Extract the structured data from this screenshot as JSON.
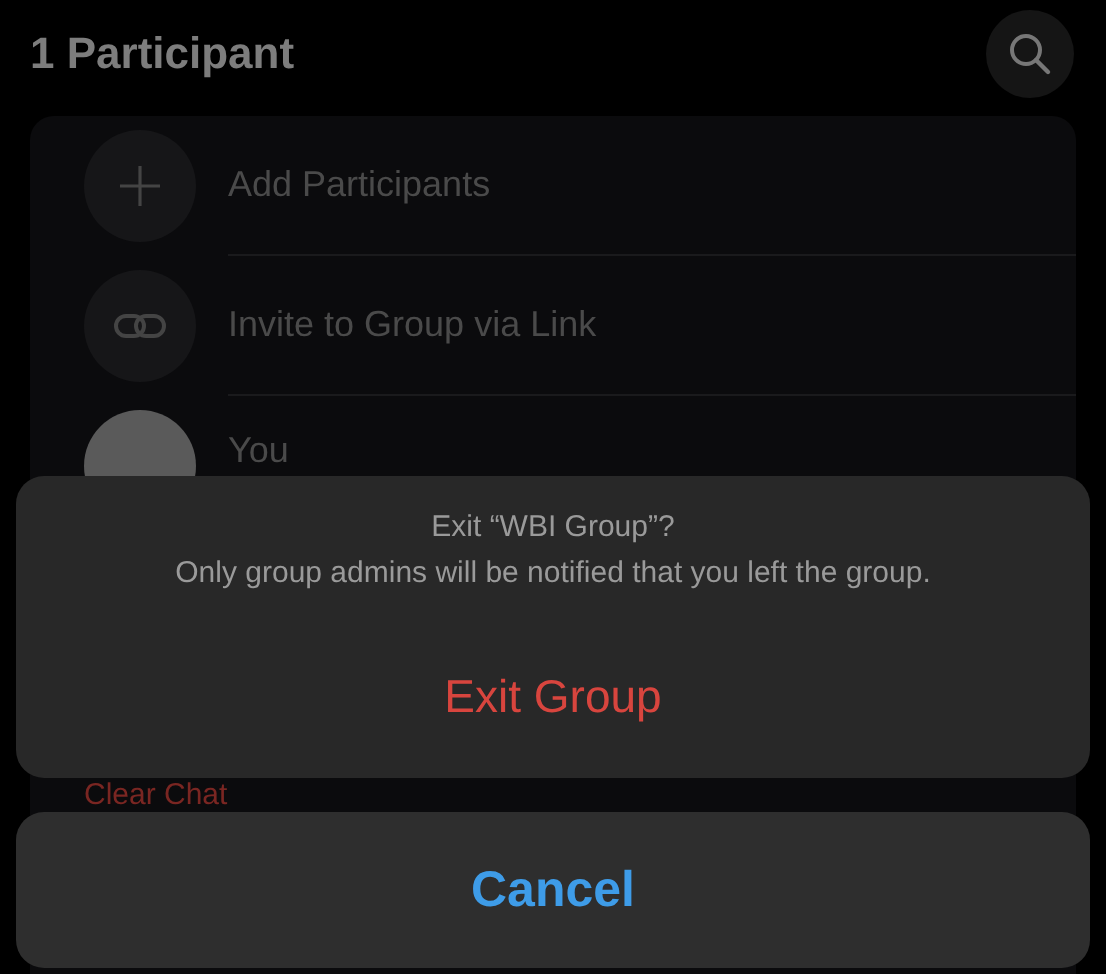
{
  "header": {
    "title": "1 Participant"
  },
  "participants_list": [
    {
      "kind": "add",
      "label": "Add Participants"
    },
    {
      "kind": "link",
      "label": "Invite to Group via Link"
    },
    {
      "kind": "avatar",
      "label": "You"
    }
  ],
  "group_actions": [
    "Clear Chat"
  ],
  "action_sheet": {
    "title": "Exit “WBI Group”?",
    "message": "Only group admins will be notified that you left the group.",
    "actions": [
      {
        "label": "Exit Group",
        "destructive": true
      }
    ],
    "cancel": "Cancel"
  }
}
